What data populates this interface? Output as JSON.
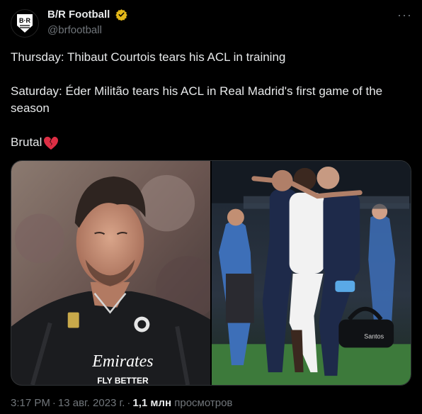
{
  "author": {
    "display_name": "B/R Football",
    "handle": "@brfootball",
    "avatar_letters": "B·R",
    "verified": true
  },
  "tweet": {
    "line1": "Thursday: Thibaut Courtois tears his ACL in training",
    "line2": "Saturday: Éder Militão tears his ACL in Real Madrid's first game of the season",
    "line3": "Brutal"
  },
  "media": {
    "photo1_shirt_text": "Emirates",
    "photo1_shirt_subtext": "FLY BETTER",
    "photo2_sponsor_text": "Santos"
  },
  "meta": {
    "time": "3:17 PM",
    "date": "13 авг. 2023 г.",
    "views_count": "1,1 млн",
    "views_label": "просмотров"
  },
  "colors": {
    "background": "#000000",
    "text_primary": "#e7e9ea",
    "text_secondary": "#71767b",
    "verified_badge": "#e2b719"
  },
  "icons": [
    "more-icon",
    "verified-badge-icon",
    "broken-heart-icon"
  ]
}
